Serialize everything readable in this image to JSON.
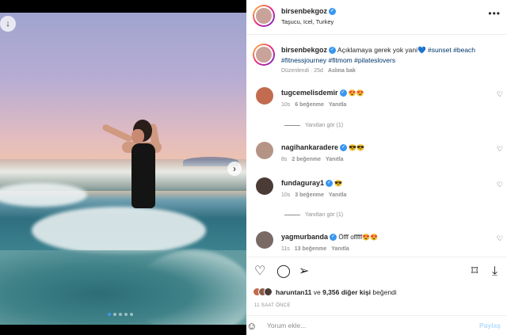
{
  "post": {
    "author": "birsenbekgoz",
    "location": "Taşucu, Icel, Turkey",
    "more_icon": "more-horizontal-icon"
  },
  "caption": {
    "author": "birsenbekgoz",
    "text": "Açıklamaya gerek yok yani",
    "heart": "💙",
    "hashtags_line1": "#sunset #beach",
    "hashtags_line2": "#fitnessjourney #fitmom #pilateslovers",
    "edited": "Düzenlendi · 25d",
    "see_original": "Aslına bak"
  },
  "comments": [
    {
      "user": "tugcemelisdemir",
      "text": "😍😍",
      "time": "10s",
      "likes": "6 beğenme",
      "reply": "Yanıtla",
      "view_replies": "Yanıtları gör (1)"
    },
    {
      "user": "nagihankaradere",
      "text": "😎😎",
      "time": "8s",
      "likes": "2 beğenme",
      "reply": "Yanıtla"
    },
    {
      "user": "fundaguray1",
      "text": "😎",
      "time": "10s",
      "likes": "3 beğenme",
      "reply": "Yanıtla",
      "view_replies": "Yanıtları gör (1)"
    },
    {
      "user": "yagmurbanda",
      "text": "Öfff offfff😍😍",
      "time": "11s",
      "likes": "13 beğenme",
      "reply": "Yanıtla"
    }
  ],
  "likes": {
    "user": "haruntan11",
    "connector": "ve",
    "others": "9,356 diğer kişi",
    "suffix": "beğendi"
  },
  "timestamp": "11 SAAT ÖNCE",
  "add_comment": {
    "placeholder": "Yorum ekle...",
    "post_label": "Paylaş"
  },
  "carousel": {
    "count": 5,
    "active_index": 0
  },
  "colors": {
    "accent": "#3897f0",
    "link": "#00376b",
    "muted": "#8e8e8e",
    "post_disabled": "#b3dbff"
  }
}
